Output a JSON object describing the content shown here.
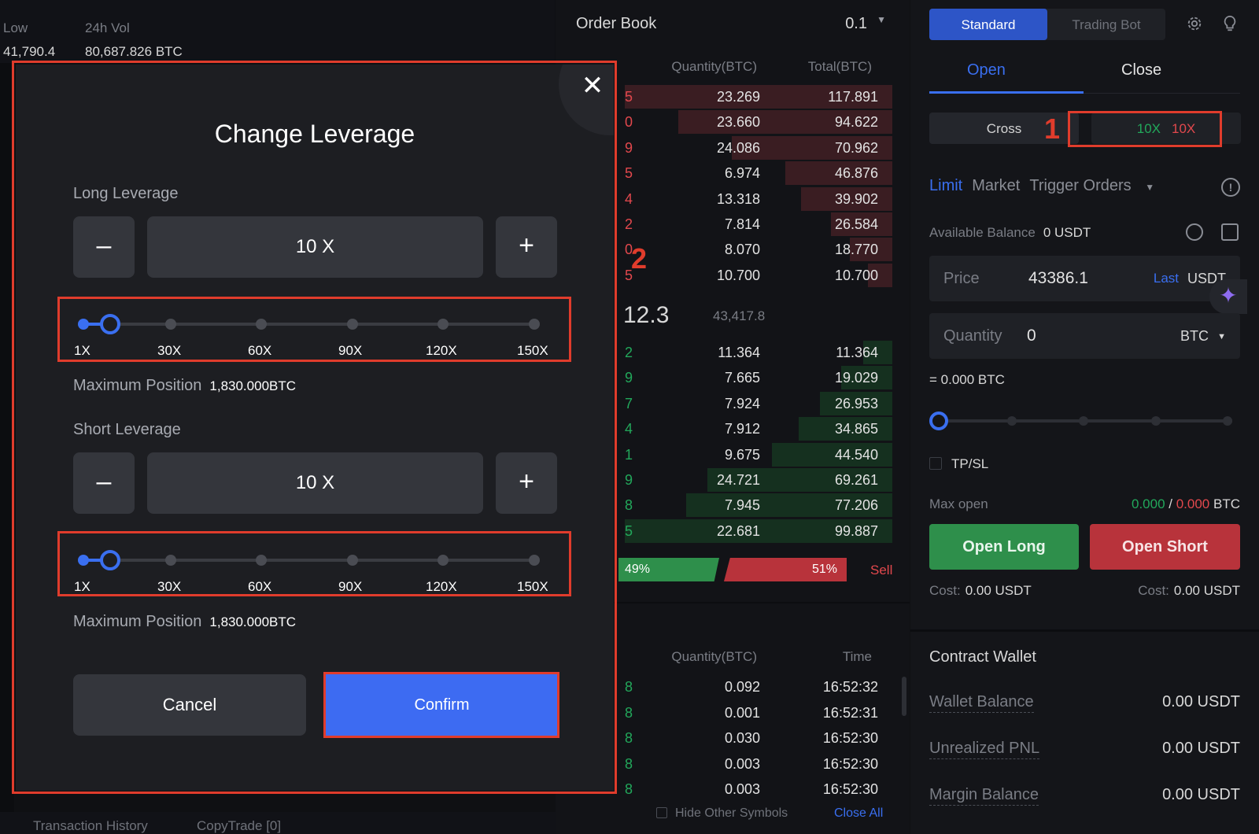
{
  "market": {
    "low_label": "Low",
    "low_value": "41,790.4",
    "vol_label": "24h Vol",
    "vol_value": "80,687.826",
    "vol_unit": "BTC"
  },
  "bottom_tabs": [
    "Transaction History",
    "CopyTrade [0]"
  ],
  "orderbook": {
    "title": "Order Book",
    "step": "0.1",
    "col_quantity": "Quantity(BTC)",
    "col_total": "Total(BTC)",
    "asks": [
      {
        "edge": "5",
        "quantity": "23.269",
        "total": "117.891",
        "depth": 1.0
      },
      {
        "edge": "0",
        "quantity": "23.660",
        "total": "94.622",
        "depth": 0.8
      },
      {
        "edge": "9",
        "quantity": "24.086",
        "total": "70.962",
        "depth": 0.6
      },
      {
        "edge": "5",
        "quantity": "6.974",
        "total": "46.876",
        "depth": 0.4
      },
      {
        "edge": "4",
        "quantity": "13.318",
        "total": "39.902",
        "depth": 0.34
      },
      {
        "edge": "2",
        "quantity": "7.814",
        "total": "26.584",
        "depth": 0.23
      },
      {
        "edge": "0",
        "quantity": "8.070",
        "total": "18.770",
        "depth": 0.16
      },
      {
        "edge": "5",
        "quantity": "10.700",
        "total": "10.700",
        "depth": 0.09
      }
    ],
    "mid_price": "12.3",
    "mid_index": "43,417.8",
    "bids": [
      {
        "edge": "2",
        "quantity": "11.364",
        "total": "11.364",
        "depth": 0.11
      },
      {
        "edge": "9",
        "quantity": "7.665",
        "total": "19.029",
        "depth": 0.19
      },
      {
        "edge": "7",
        "quantity": "7.924",
        "total": "26.953",
        "depth": 0.27
      },
      {
        "edge": "4",
        "quantity": "7.912",
        "total": "34.865",
        "depth": 0.35
      },
      {
        "edge": "1",
        "quantity": "9.675",
        "total": "44.540",
        "depth": 0.45
      },
      {
        "edge": "9",
        "quantity": "24.721",
        "total": "69.261",
        "depth": 0.69
      },
      {
        "edge": "8",
        "quantity": "7.945",
        "total": "77.206",
        "depth": 0.77
      },
      {
        "edge": "5",
        "quantity": "22.681",
        "total": "99.887",
        "depth": 1.0
      }
    ],
    "buy_ratio": "49%",
    "sell_ratio": "51%",
    "sell_label": "Sell",
    "trades_col_quantity": "Quantity(BTC)",
    "trades_col_time": "Time",
    "trades": [
      {
        "edge": "8",
        "quantity": "0.092",
        "time": "16:52:32"
      },
      {
        "edge": "8",
        "quantity": "0.001",
        "time": "16:52:31"
      },
      {
        "edge": "8",
        "quantity": "0.030",
        "time": "16:52:30"
      },
      {
        "edge": "8",
        "quantity": "0.003",
        "time": "16:52:30"
      },
      {
        "edge": "8",
        "quantity": "0.003",
        "time": "16:52:30"
      }
    ],
    "hide_other_symbols": "Hide Other Symbols",
    "close_all": "Close All"
  },
  "panel": {
    "mode_standard": "Standard",
    "mode_trading_bot": "Trading Bot",
    "tab_open": "Open",
    "tab_close": "Close",
    "margin_mode": "Cross",
    "long_leverage": "10X",
    "short_leverage": "10X",
    "annotation_1": "1",
    "order_limit": "Limit",
    "order_market": "Market",
    "order_trigger": "Trigger Orders",
    "available_balance_label": "Available Balance",
    "available_balance_value": "0 USDT",
    "price_label": "Price",
    "price_value": "43386.1",
    "price_last": "Last",
    "price_unit": "USDT",
    "quantity_label": "Quantity",
    "quantity_value": "0",
    "quantity_unit": "BTC",
    "equiv_btc": "= 0.000 BTC",
    "tpsl_label": "TP/SL",
    "max_open_label": "Max open",
    "max_open_long": "0.000",
    "max_open_sep": " / ",
    "max_open_short": "0.000",
    "max_open_unit": " BTC",
    "open_long": "Open Long",
    "open_short": "Open Short",
    "cost_label": "Cost:",
    "cost_long": "0.00 USDT",
    "cost_short": "0.00 USDT",
    "wallet_title": "Contract Wallet",
    "wallet_rows": [
      {
        "label": "Wallet Balance",
        "value": "0.00 USDT"
      },
      {
        "label": "Unrealized PNL",
        "value": "0.00 USDT"
      },
      {
        "label": "Margin Balance",
        "value": "0.00 USDT"
      }
    ]
  },
  "modal": {
    "title": "Change Leverage",
    "annotation_2": "2",
    "long_label": "Long Leverage",
    "long_value": "10  X",
    "short_label": "Short Leverage",
    "short_value": "10  X",
    "ticks": [
      "1X",
      "30X",
      "60X",
      "90X",
      "120X",
      "150X"
    ],
    "max_position_label": "Maximum Position",
    "max_position_value": "1,830.000BTC",
    "cancel": "Cancel",
    "confirm": "Confirm",
    "minus": "–",
    "plus": "+"
  },
  "colors": {
    "accent": "#3a6ff0",
    "long": "#22a85b",
    "short": "#e2484d",
    "highlight": "#e03c2c"
  }
}
